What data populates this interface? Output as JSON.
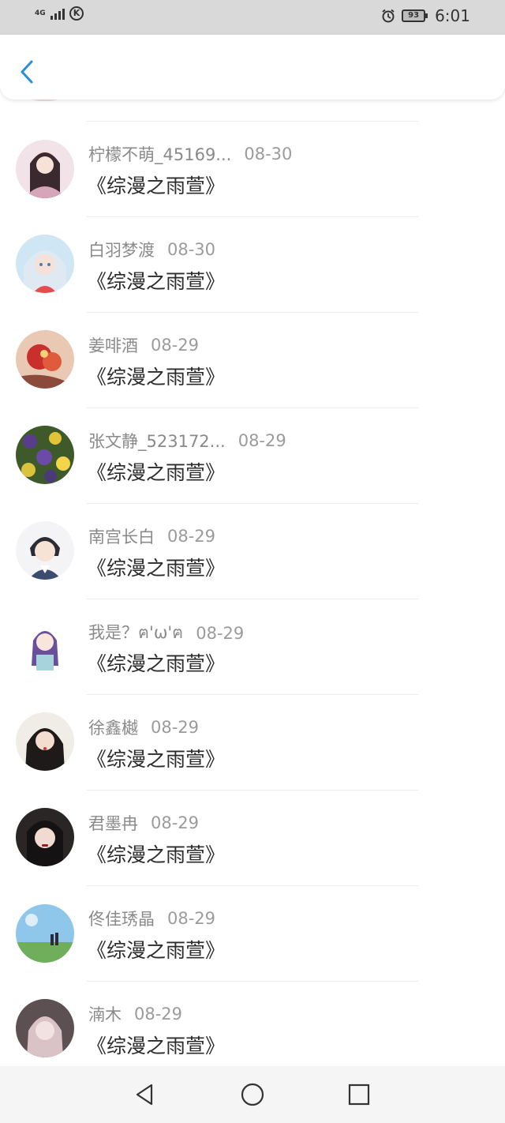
{
  "status_bar": {
    "network": "4G",
    "battery": "93",
    "time": "6:01"
  },
  "header": {
    "back_icon": "chevron-left-icon"
  },
  "list": [
    {
      "name": "柠檬不萌_45169...",
      "time": "08-30",
      "title": "《综漫之雨萱》"
    },
    {
      "name": "白羽梦渡",
      "time": "08-30",
      "title": "《综漫之雨萱》"
    },
    {
      "name": "姜啡酒",
      "time": "08-29",
      "title": "《综漫之雨萱》"
    },
    {
      "name": "张文静_523172...",
      "time": "08-29",
      "title": "《综漫之雨萱》"
    },
    {
      "name": "南宫长白",
      "time": "08-29",
      "title": "《综漫之雨萱》"
    },
    {
      "name": "我是？ฅ'ω'ฅ",
      "time": "08-29",
      "title": "《综漫之雨萱》"
    },
    {
      "name": "徐鑫樾",
      "time": "08-29",
      "title": "《综漫之雨萱》"
    },
    {
      "name": "君墨冉",
      "time": "08-29",
      "title": "《综漫之雨萱》"
    },
    {
      "name": "佟佳琇晶",
      "time": "08-29",
      "title": "《综漫之雨萱》"
    },
    {
      "name": "湳木",
      "time": "08-29",
      "title": "《综漫之雨萱》"
    }
  ],
  "colors": {
    "accent": "#2a8fd6",
    "status_bar_bg": "#d9d9d9",
    "nav_bar_bg": "#f5f5f5"
  },
  "nav_bar": {
    "icons": [
      "back-triangle-icon",
      "home-circle-icon",
      "recents-square-icon"
    ]
  }
}
